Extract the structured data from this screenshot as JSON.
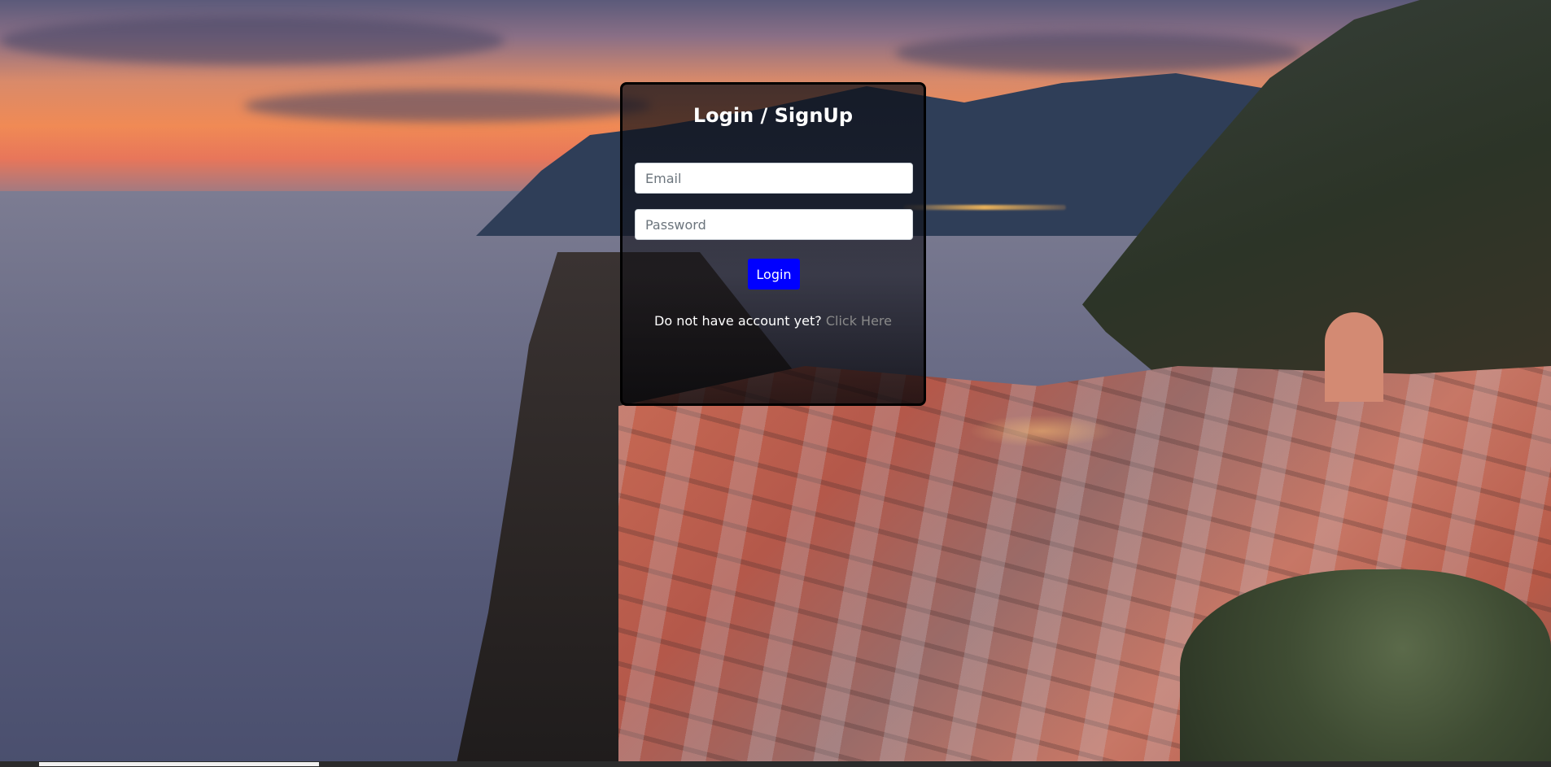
{
  "login": {
    "title": "Login / SignUp",
    "email_placeholder": "Email",
    "email_value": "",
    "password_placeholder": "Password",
    "password_value": "",
    "submit_label": "Login",
    "signup_prompt": "Do not have account yet?",
    "signup_link_label": "Click Here"
  },
  "colors": {
    "button_bg": "#0000ff",
    "link_color": "#8a8a8a",
    "card_border": "#000000"
  },
  "icons": {
    "background": "coastal-village-sunset-photo"
  }
}
